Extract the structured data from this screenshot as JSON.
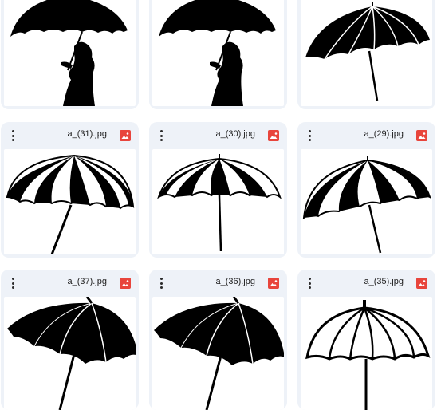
{
  "files": [
    {
      "name": "",
      "type_icon": "image-file-icon",
      "thumbnail": "woman-umbrella-silhouette"
    },
    {
      "name": "",
      "type_icon": "image-file-icon",
      "thumbnail": "woman-umbrella-silhouette"
    },
    {
      "name": "",
      "type_icon": "image-file-icon",
      "thumbnail": "black-umbrella-white-ribs"
    },
    {
      "name": "a_(31).jpg",
      "type_icon": "image-file-icon",
      "thumbnail": "striped-umbrella"
    },
    {
      "name": "a_(30).jpg",
      "type_icon": "image-file-icon",
      "thumbnail": "striped-umbrella"
    },
    {
      "name": "a_(29).jpg",
      "type_icon": "image-file-icon",
      "thumbnail": "striped-umbrella"
    },
    {
      "name": "a_(37).jpg",
      "type_icon": "image-file-icon",
      "thumbnail": "black-umbrella"
    },
    {
      "name": "a_(36).jpg",
      "type_icon": "image-file-icon",
      "thumbnail": "black-umbrella"
    },
    {
      "name": "a_(35).jpg",
      "type_icon": "image-file-icon",
      "thumbnail": "outline-umbrella"
    }
  ],
  "colors": {
    "card_bg": "#eef2f8",
    "image_icon_red": "#e8453c"
  }
}
